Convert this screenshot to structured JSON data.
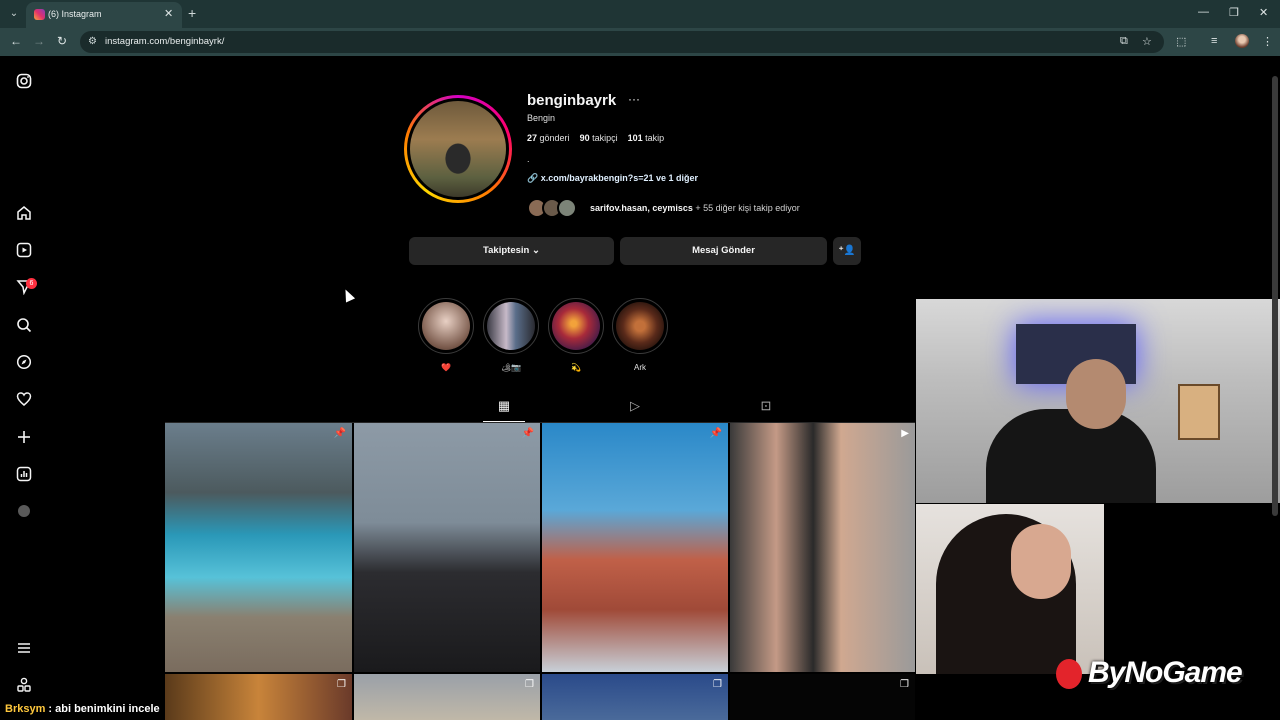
{
  "browser": {
    "tab_title": "(6) Instagram",
    "url": "instagram.com/benginbayrk/"
  },
  "sidebar": {
    "notification_count": "6"
  },
  "profile": {
    "username": "benginbayrk",
    "full_name": "Bengin",
    "posts_count": "27",
    "posts_label": "gönderi",
    "followers_count": "90",
    "followers_label": "takipçi",
    "following_count": "101",
    "following_label": "takip",
    "bio": ".",
    "link_text": "x.com/bayrakbengin?s=21 ve 1 diğer",
    "followed_by_names": "sarifov.hasan, ceymiscs",
    "followed_by_rest": " + 55 diğer kişi takip ediyor"
  },
  "actions": {
    "following_button": "Takiptesin",
    "message_button": "Mesaj Gönder"
  },
  "highlights": [
    {
      "label": "❤️"
    },
    {
      "label": "🏕📷"
    },
    {
      "label": "💫"
    },
    {
      "label": "Ark"
    }
  ],
  "overlay": {
    "logo_text": "ByNoGame",
    "chat_user": "Brksym",
    "chat_message": " : abi benimkini incele"
  },
  "colors": {
    "accent_story_ring": "#ff0069",
    "badge": "#ff3040",
    "button_bg": "#262626"
  }
}
